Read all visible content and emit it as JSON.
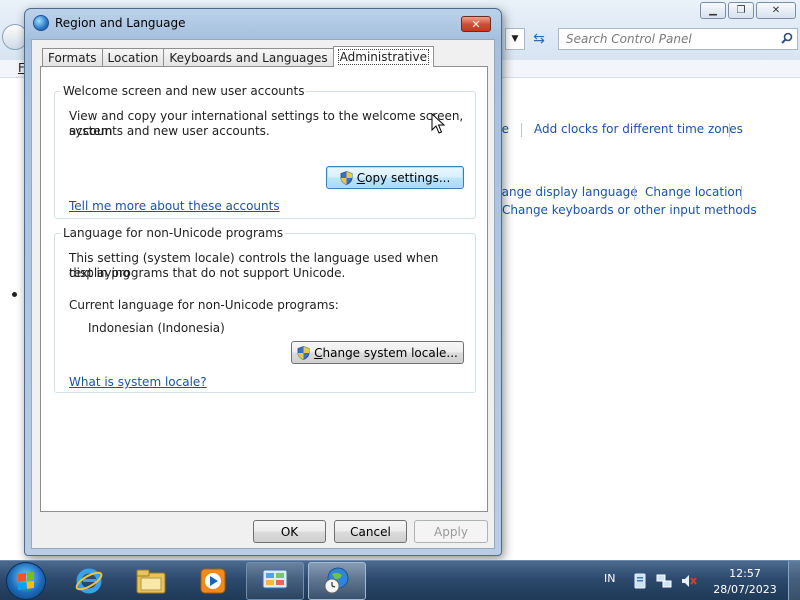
{
  "background_window": {
    "search_placeholder": "Search Control Panel",
    "menu_item": "F",
    "links": {
      "partial_time": "ne",
      "add_clocks": "Add clocks for different time zones",
      "change_display_language": "hange display language",
      "change_location": "Change location",
      "change_keyboards": "Change keyboards or other input methods"
    }
  },
  "dialog": {
    "title": "Region and Language",
    "close_label": "✕",
    "tabs": [
      {
        "label": "Formats"
      },
      {
        "label": "Location"
      },
      {
        "label": "Keyboards and Languages"
      },
      {
        "label": "Administrative"
      }
    ],
    "welcome_group": {
      "legend": "Welcome screen and new user accounts",
      "text_line1": "View and copy your international settings to the welcome screen, system",
      "text_line2": "accounts and new user accounts.",
      "copy_button_ul": "C",
      "copy_button_rest": "opy settings...",
      "link": "Tell me more about these accounts"
    },
    "unicode_group": {
      "legend": "Language for non-Unicode programs",
      "text_line1": "This setting (system locale) controls the language used when displaying",
      "text_line2": "text in programs that do not support Unicode.",
      "current_label": "Current language for non-Unicode programs:",
      "current_value": "Indonesian (Indonesia)",
      "change_button_ul": "C",
      "change_button_rest": "hange system locale...",
      "link": "What is system locale?"
    },
    "buttons": {
      "ok": "OK",
      "cancel": "Cancel",
      "apply": "Apply"
    }
  },
  "taskbar": {
    "language": "IN",
    "time": "12:57",
    "date": "28/07/2023"
  }
}
